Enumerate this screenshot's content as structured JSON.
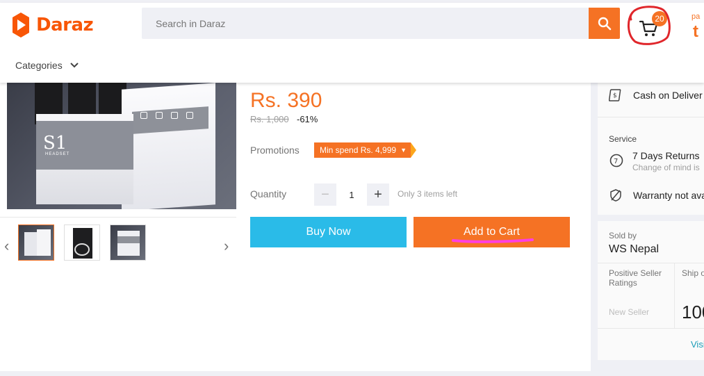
{
  "header": {
    "brand": "Daraz",
    "search_placeholder": "Search in Daraz",
    "cart_count": "20",
    "promo_line1": "pa",
    "promo_line2": "t F",
    "categories_label": "Categories"
  },
  "product": {
    "price": "Rs. 390",
    "original_price": "Rs. 1,000",
    "discount": "-61%",
    "promotions_label": "Promotions",
    "promotion_tag": "Min spend Rs. 4,999",
    "quantity_label": "Quantity",
    "quantity_value": "1",
    "stock_note": "Only 3 items left",
    "buy_now_label": "Buy Now",
    "add_to_cart_label": "Add to Cart",
    "image_text": "S1",
    "image_subtext": "HEADSET"
  },
  "delivery": {
    "cod_label": "Cash on Deliver"
  },
  "service": {
    "title": "Service",
    "returns_label": "7 Days Returns",
    "returns_sub": "Change of mind is",
    "warranty_label": "Warranty not ava"
  },
  "seller": {
    "sold_by_label": "Sold by",
    "name": "WS Nepal",
    "positive_ratings_label": "Positive Seller Ratings",
    "positive_ratings_value": "New Seller",
    "ship_label": "Ship o",
    "ship_value": "100",
    "visit_label": "Visi"
  },
  "colors": {
    "brand_orange": "#f57224",
    "buy_now_blue": "#2abbe8",
    "annotation_red": "#e0262b",
    "annotation_pink": "#ff3fe0"
  }
}
